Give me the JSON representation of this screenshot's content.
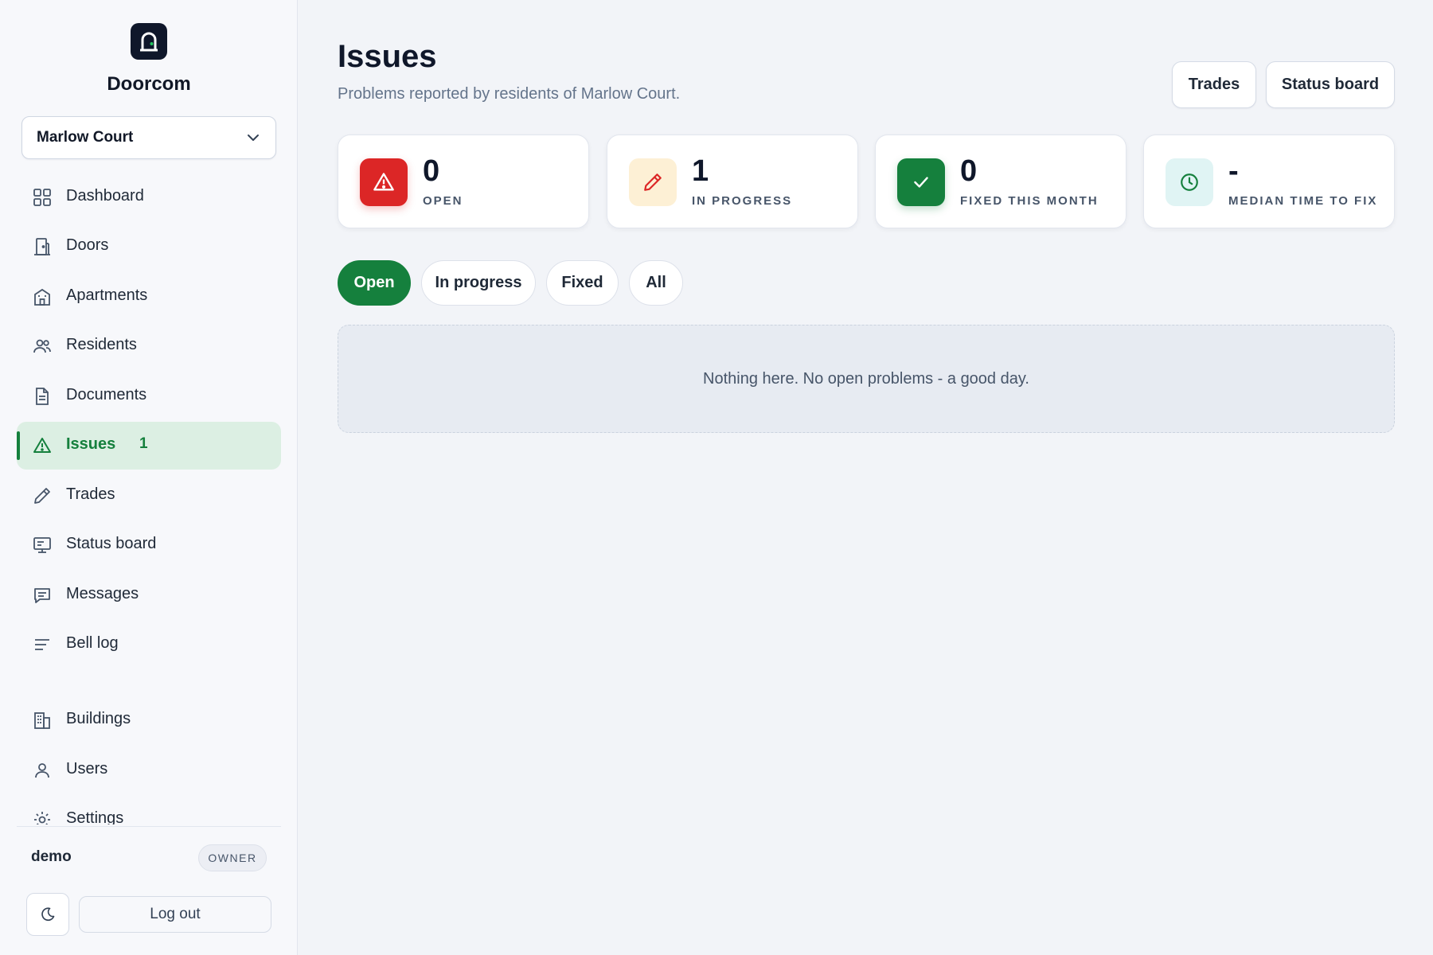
{
  "app": {
    "brand": "Doorcom"
  },
  "sidebar": {
    "building_select": "Marlow Court",
    "items": [
      {
        "label": "Dashboard",
        "icon": "grid-icon"
      },
      {
        "label": "Doors",
        "icon": "door-icon"
      },
      {
        "label": "Apartments",
        "icon": "apartment-icon"
      },
      {
        "label": "Residents",
        "icon": "people-icon"
      },
      {
        "label": "Documents",
        "icon": "document-icon"
      },
      {
        "label": "Issues",
        "icon": "warning-icon",
        "badge": "1",
        "active": true
      },
      {
        "label": "Trades",
        "icon": "pencil-icon"
      },
      {
        "label": "Status board",
        "icon": "monitor-icon"
      },
      {
        "label": "Messages",
        "icon": "chat-icon"
      },
      {
        "label": "Bell log",
        "icon": "list-icon"
      }
    ],
    "admin_items": [
      {
        "label": "Buildings",
        "icon": "building-icon"
      },
      {
        "label": "Users",
        "icon": "user-icon"
      },
      {
        "label": "Settings",
        "icon": "gear-icon"
      }
    ],
    "user": {
      "name": "demo",
      "role": "OWNER"
    },
    "logout_label": "Log out"
  },
  "header": {
    "title": "Issues",
    "subtitle": "Problems reported by residents of Marlow Court.",
    "trades_button": "Trades",
    "status_board_button": "Status board"
  },
  "stats": [
    {
      "value": "0",
      "label": "OPEN",
      "icon": "warning-icon",
      "color": "#dc2626"
    },
    {
      "value": "1",
      "label": "IN PROGRESS",
      "icon": "pencil-icon",
      "color": "#fdf0d5"
    },
    {
      "value": "0",
      "label": "FIXED THIS MONTH",
      "icon": "check-icon",
      "color": "#15803d"
    },
    {
      "value": "-",
      "label": "MEDIAN TIME TO FIX",
      "icon": "clock-icon",
      "color": "#e0f4f4"
    }
  ],
  "filters": [
    {
      "label": "Open",
      "active": true
    },
    {
      "label": "In progress",
      "active": false
    },
    {
      "label": "Fixed",
      "active": false
    },
    {
      "label": "All",
      "active": false
    }
  ],
  "empty_message": "Nothing here. No open problems - a good day.",
  "colors": {
    "accent": "#15803d",
    "danger": "#dc2626",
    "text": "#0f172a"
  }
}
